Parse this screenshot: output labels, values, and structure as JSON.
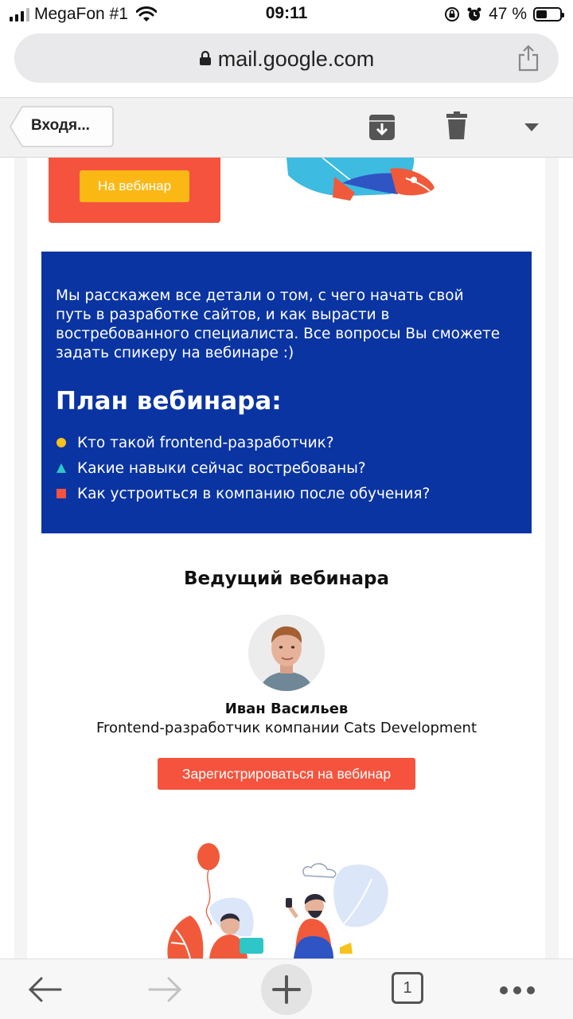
{
  "status_bar": {
    "carrier": "MegaFon #1",
    "time": "09:11",
    "battery_percent": "47 %",
    "battery_level": 0.47,
    "icons": [
      "signal-icon",
      "wifi-icon",
      "orientation-lock-icon",
      "alarm-icon",
      "battery-icon"
    ]
  },
  "browser": {
    "url": "mail.google.com",
    "icons": [
      "lock-icon",
      "share-icon"
    ],
    "open_tabs": "1",
    "bottom_icons": [
      "back-arrow-icon",
      "forward-arrow-icon",
      "plus-icon",
      "tabs-icon",
      "more-dots-icon"
    ]
  },
  "mail_toolbar": {
    "back_label": "Входя...",
    "icons": [
      "archive-icon",
      "trash-icon",
      "chevron-down-icon"
    ]
  },
  "email": {
    "promo_button": "На вебинар",
    "intro_text": "Мы расскажем все детали о том, с чего начать свой путь в разработке сайтов, и как вырасти в востребованного специалиста. Все вопросы Вы сможете задать спикеру на вебинаре :)",
    "plan_title": "План вебинара:",
    "plan_items": [
      {
        "text": "Кто такой frontend-разработчик?",
        "bullet": "circle",
        "color": "#f7c21b"
      },
      {
        "text": "Какие навыки сейчас востребованы?",
        "bullet": "triangle",
        "color": "#2ec6c6"
      },
      {
        "text": "Как устроиться в компанию после обучения?",
        "bullet": "square",
        "color": "#f5533d"
      }
    ],
    "host_title": "Ведущий вебинара",
    "host_name": "Иван Васильев",
    "host_role": "Frontend-разработчик компании Cats Development",
    "register_button": "Зарегистрироваться на вебинар"
  },
  "colors": {
    "accent_red": "#f5533d",
    "accent_yellow": "#fbb815",
    "block_blue": "#0a34a2"
  }
}
